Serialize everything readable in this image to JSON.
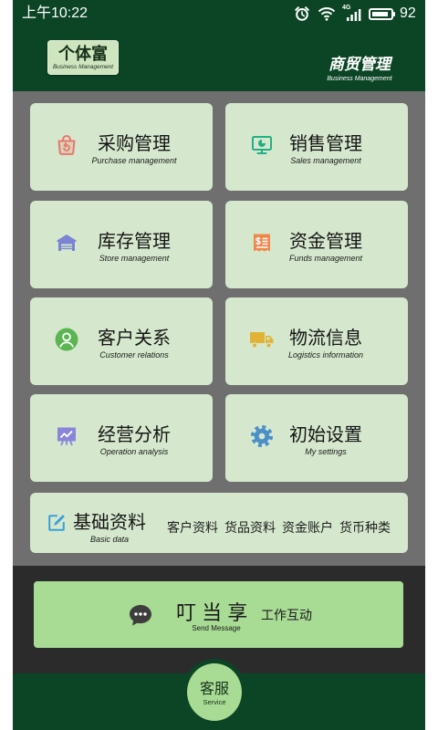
{
  "status_bar": {
    "time": "上午10:22",
    "network": "4G",
    "battery": "92",
    "icons": [
      "alarm-icon",
      "wifi-icon",
      "signal-icon",
      "battery-icon"
    ]
  },
  "header": {
    "logo_title": "个体富",
    "logo_subtitle": "Business Management",
    "title": "商贸管理",
    "subtitle": "Business Management"
  },
  "modules": [
    {
      "title": "采购管理",
      "subtitle": "Purchase management",
      "icon": "shopping-bag-icon",
      "color": "#e9766b"
    },
    {
      "title": "销售管理",
      "subtitle": "Sales management",
      "icon": "monitor-chart-icon",
      "color": "#22b084"
    },
    {
      "title": "库存管理",
      "subtitle": "Store management",
      "icon": "warehouse-icon",
      "color": "#7b84d4"
    },
    {
      "title": "资金管理",
      "subtitle": "Funds management",
      "icon": "receipt-dollar-icon",
      "color": "#ee874c"
    },
    {
      "title": "客户关系",
      "subtitle": "Customer relations",
      "icon": "user-circle-icon",
      "color": "#5cb552"
    },
    {
      "title": "物流信息",
      "subtitle": "Logistics information",
      "icon": "truck-icon",
      "color": "#e0b236"
    },
    {
      "title": "经营分析",
      "subtitle": "Operation analysis",
      "icon": "analytics-board-icon",
      "color": "#8a85d8"
    },
    {
      "title": "初始设置",
      "subtitle": "My settings",
      "icon": "gear-icon",
      "color": "#4a8fc6"
    }
  ],
  "basic_data": {
    "title": "基础资料",
    "subtitle": "Basic data",
    "icon": "edit-icon",
    "color": "#3a9fd8",
    "links": [
      "客户资料",
      "货品资料",
      "资金账户",
      "货币种类"
    ]
  },
  "message_button": {
    "title": "叮 当 享",
    "label": "工作互动",
    "subtitle": "Send Message",
    "icon": "chat-icon"
  },
  "service_button": {
    "label": "客服",
    "subtitle": "Service"
  },
  "colors": {
    "brand_dark_green": "#0c4526",
    "card_background": "#d5e8cd",
    "button_green": "#a8db94",
    "panel_gray": "#6f6f6f",
    "dock_dark": "#2b2b2b"
  }
}
